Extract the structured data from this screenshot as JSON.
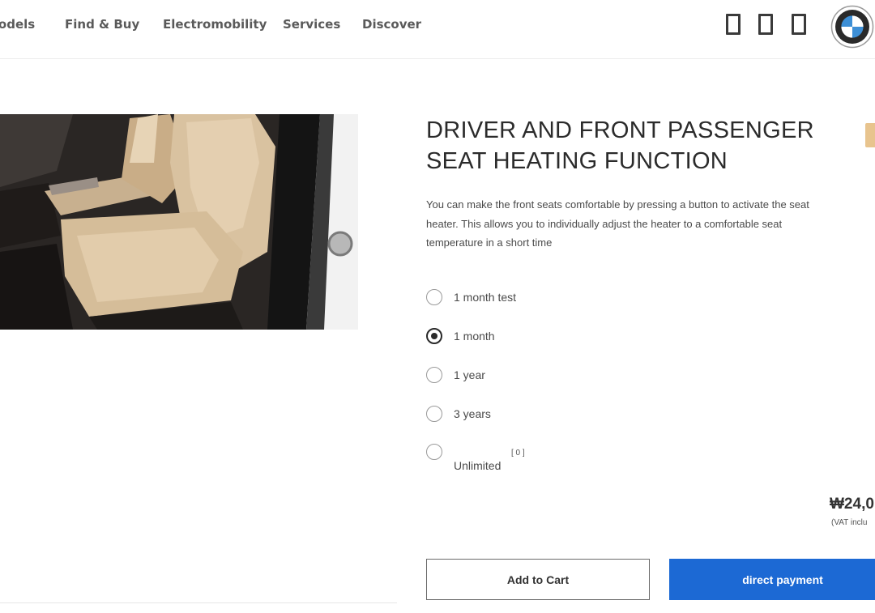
{
  "nav": {
    "items": [
      "Models",
      "Find & Buy",
      "Electromobility",
      "Services",
      "Discover"
    ],
    "icons": [
      "account-icon",
      "bookmark-icon",
      "cart-icon"
    ],
    "logo": "bmw-logo"
  },
  "product": {
    "title_line1": "DRIVER AND FRONT PASSENGER",
    "title_line2": "SEAT HEATING FUNCTION",
    "description": [
      "You can make the front seats comfortable by pressing a button to activate the seat",
      "heater. This allows you to individually adjust the heater to a comfortable seat",
      "temperature in a short time"
    ],
    "options": [
      {
        "label": "1 month test",
        "selected": false
      },
      {
        "label": "1 month",
        "selected": true
      },
      {
        "label": "1 year",
        "selected": false
      },
      {
        "label": "3 years",
        "selected": false
      },
      {
        "label": "Unlimited",
        "selected": false,
        "footnote": "[ 0 ]"
      }
    ],
    "price": "₩24,0",
    "vat_note": "(VAT inclu"
  },
  "actions": {
    "add_to_cart": "Add to Cart",
    "direct_payment": "direct payment"
  },
  "colors": {
    "accent": "#1c69d4",
    "seat": "#d9c2a0",
    "badge": "#e8c48e"
  }
}
